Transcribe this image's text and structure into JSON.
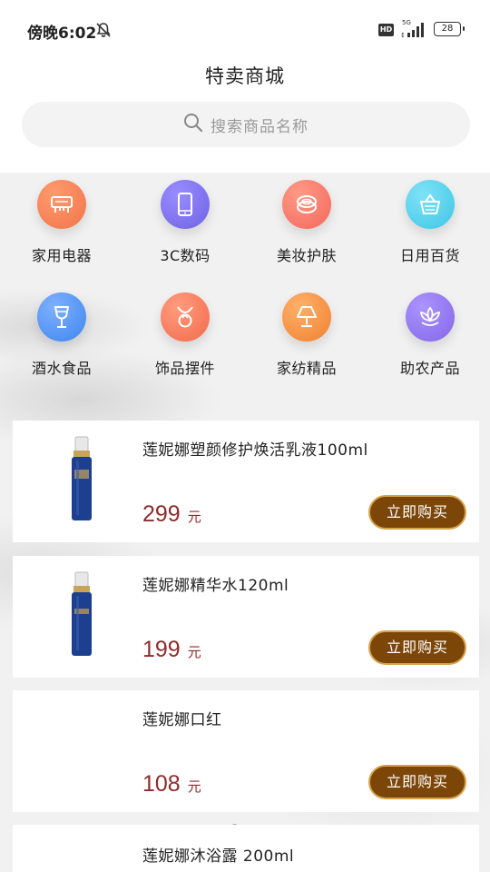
{
  "status_bar": {
    "time": "傍晚6:02",
    "hd": "HD",
    "network": "5G",
    "battery": "28"
  },
  "header": {
    "title": "特卖商城"
  },
  "search": {
    "placeholder": "搜索商品名称"
  },
  "categories": [
    {
      "label": "家用电器",
      "icon": "appliance-icon",
      "color": "#f2744a"
    },
    {
      "label": "3C数码",
      "icon": "phone-icon",
      "color": "#6f62e3"
    },
    {
      "label": "美妆护肤",
      "icon": "compact-icon",
      "color": "#f3675c"
    },
    {
      "label": "日用百货",
      "icon": "basket-icon",
      "color": "#3ec6e6"
    },
    {
      "label": "酒水食品",
      "icon": "wine-glass-icon",
      "color": "#3d86ee"
    },
    {
      "label": "饰品摆件",
      "icon": "necklace-icon",
      "color": "#f26a4d"
    },
    {
      "label": "家纺精品",
      "icon": "lamp-icon",
      "color": "#f0812f"
    },
    {
      "label": "助农产品",
      "icon": "flower-icon",
      "color": "#8366e6"
    }
  ],
  "products": [
    {
      "name": "莲妮娜塑颜修护焕活乳液100ml",
      "price": "299",
      "unit": "元",
      "button": "立即购买"
    },
    {
      "name": "莲妮娜精华水120ml",
      "price": "199",
      "unit": "元",
      "button": "立即购买"
    },
    {
      "name": "莲妮娜口红",
      "price": "108",
      "unit": "元",
      "button": "立即购买"
    },
    {
      "name": "莲妮娜沐浴露 200ml",
      "price": "",
      "unit": "",
      "button": ""
    }
  ],
  "colors": {
    "price": "#8e2b2b",
    "button_bg": "#7c4609",
    "button_border": "#d6a24a"
  }
}
